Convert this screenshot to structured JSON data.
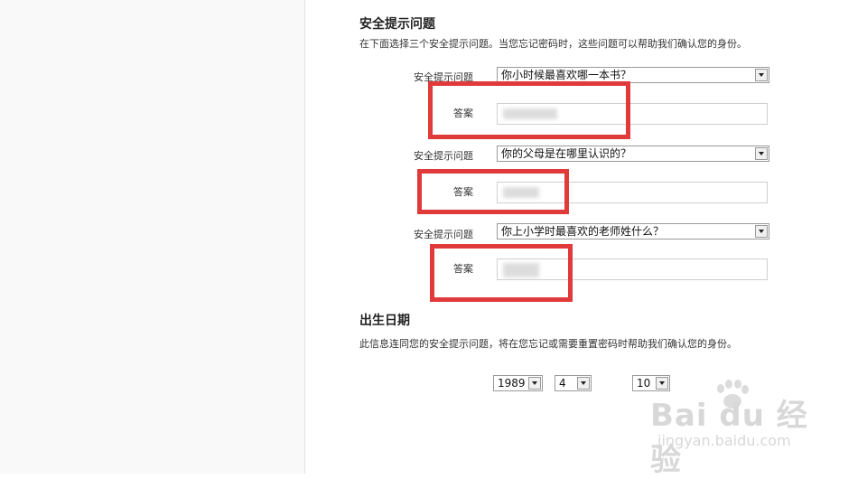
{
  "security": {
    "title": "安全提示问题",
    "description": "在下面选择三个安全提示问题。当您忘记密码时，这些问题可以帮助我们确认您的身份。",
    "question_label": "安全提示问题",
    "answer_label": "答案",
    "questions": [
      {
        "selected": "你小时候最喜欢哪一本书？"
      },
      {
        "selected": "你的父母是在哪里认识的？"
      },
      {
        "selected": "你上小学时最喜欢的老师姓什么？"
      }
    ]
  },
  "birthdate": {
    "title": "出生日期",
    "description": "此信息连同您的安全提示问题，将在您忘记或需要重置密码时帮助我们确认您的身份。",
    "year": "1989",
    "month": "4",
    "day": "10"
  },
  "watermark": {
    "brand": "Bai du 经验",
    "url": "jingyan.baidu.com"
  },
  "colors": {
    "highlight": "#e03a3a"
  }
}
